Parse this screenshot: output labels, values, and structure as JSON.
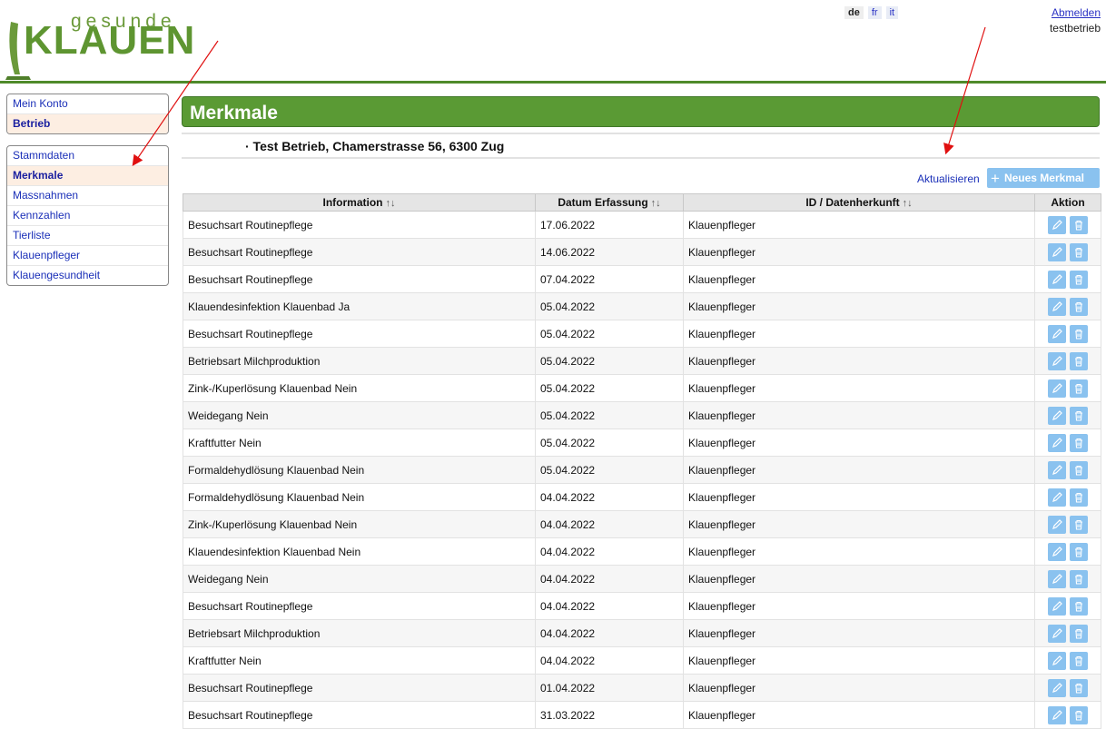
{
  "logo": {
    "small_text": "gesunde",
    "big_text": "KLAUEN"
  },
  "languages": [
    {
      "code": "de",
      "active": true
    },
    {
      "code": "fr",
      "active": false
    },
    {
      "code": "it",
      "active": false
    }
  ],
  "user": {
    "logout_label": "Abmelden",
    "username": "testbetrieb"
  },
  "sidebar": {
    "group1": [
      {
        "label": "Mein Konto",
        "active": false
      },
      {
        "label": "Betrieb",
        "active": true
      }
    ],
    "group2": [
      {
        "label": "Stammdaten",
        "active": false
      },
      {
        "label": "Merkmale",
        "active": true
      },
      {
        "label": "Massnahmen",
        "active": false
      },
      {
        "label": "Kennzahlen",
        "active": false
      },
      {
        "label": "Tierliste",
        "active": false
      },
      {
        "label": "Klauenpfleger",
        "active": false
      },
      {
        "label": "Klauengesundheit",
        "active": false
      }
    ]
  },
  "page": {
    "title": "Merkmale",
    "subtitle": "· Test Betrieb, Chamerstrasse 56, 6300 Zug",
    "refresh_label": "Aktualisieren",
    "new_button_label": "Neues Merkmal"
  },
  "table": {
    "headers": [
      "Information",
      "Datum Erfassung",
      "ID / Datenherkunft",
      "Aktion"
    ],
    "sort_icon": "↑↓",
    "rows": [
      [
        "Besuchsart Routinepflege",
        "17.06.2022",
        "Klauenpfleger"
      ],
      [
        "Besuchsart Routinepflege",
        "14.06.2022",
        "Klauenpfleger"
      ],
      [
        "Besuchsart Routinepflege",
        "07.04.2022",
        "Klauenpfleger"
      ],
      [
        "Klauendesinfektion Klauenbad Ja",
        "05.04.2022",
        "Klauenpfleger"
      ],
      [
        "Besuchsart Routinepflege",
        "05.04.2022",
        "Klauenpfleger"
      ],
      [
        "Betriebsart Milchproduktion",
        "05.04.2022",
        "Klauenpfleger"
      ],
      [
        "Zink-/Kuperlösung Klauenbad Nein",
        "05.04.2022",
        "Klauenpfleger"
      ],
      [
        "Weidegang Nein",
        "05.04.2022",
        "Klauenpfleger"
      ],
      [
        "Kraftfutter Nein",
        "05.04.2022",
        "Klauenpfleger"
      ],
      [
        "Formaldehydlösung Klauenbad Nein",
        "05.04.2022",
        "Klauenpfleger"
      ],
      [
        "Formaldehydlösung Klauenbad Nein",
        "04.04.2022",
        "Klauenpfleger"
      ],
      [
        "Zink-/Kuperlösung Klauenbad Nein",
        "04.04.2022",
        "Klauenpfleger"
      ],
      [
        "Klauendesinfektion Klauenbad Nein",
        "04.04.2022",
        "Klauenpfleger"
      ],
      [
        "Weidegang Nein",
        "04.04.2022",
        "Klauenpfleger"
      ],
      [
        "Besuchsart Routinepflege",
        "04.04.2022",
        "Klauenpfleger"
      ],
      [
        "Betriebsart Milchproduktion",
        "04.04.2022",
        "Klauenpfleger"
      ],
      [
        "Kraftfutter Nein",
        "04.04.2022",
        "Klauenpfleger"
      ],
      [
        "Besuchsart Routinepflege",
        "01.04.2022",
        "Klauenpfleger"
      ],
      [
        "Besuchsart Routinepflege",
        "31.03.2022",
        "Klauenpfleger"
      ]
    ]
  },
  "colors": {
    "brand_green": "#5a9a34",
    "button_blue": "#8ac2ef",
    "link_blue": "#1a2fb8",
    "active_bg": "#fdeee2"
  },
  "annotations": {
    "arrow_color": "#e01010"
  }
}
